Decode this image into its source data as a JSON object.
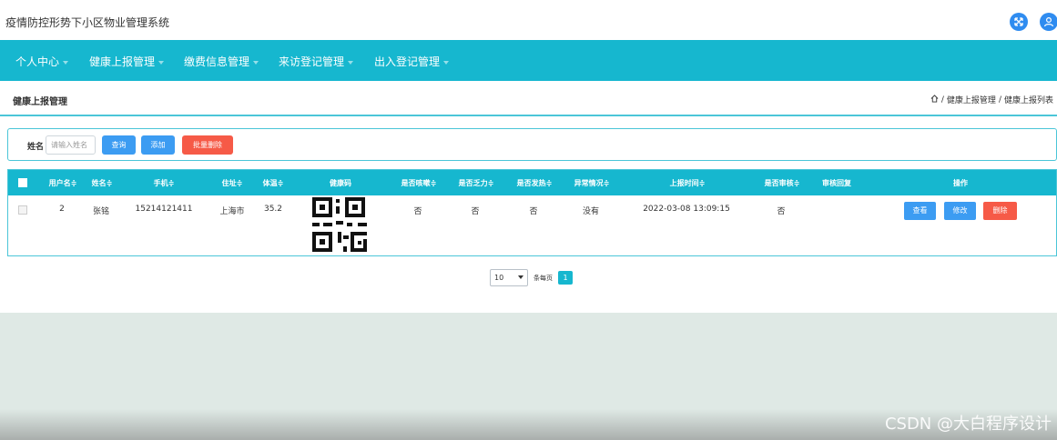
{
  "app": {
    "title": "疫情防控形势下小区物业管理系统"
  },
  "colors": {
    "accent": "#16b7cf",
    "primary_button": "#3c9cf2",
    "danger_button": "#f65a47",
    "background": "#dfe9e5"
  },
  "nav": {
    "items": [
      {
        "label": "个人中心"
      },
      {
        "label": "健康上报管理"
      },
      {
        "label": "缴费信息管理"
      },
      {
        "label": "来访登记管理"
      },
      {
        "label": "出入登记管理"
      }
    ]
  },
  "page": {
    "title": "健康上报管理",
    "breadcrumb": {
      "sep": "/",
      "level1": "健康上报管理",
      "level2": "健康上报列表"
    }
  },
  "search": {
    "label": "姓名",
    "placeholder": "请输入姓名",
    "query_label": "查询",
    "add_label": "添加",
    "batch_delete_label": "批量删除"
  },
  "table": {
    "headers": [
      "用户名≑",
      "姓名≑",
      "手机≑",
      "住址≑",
      "体温≑",
      "健康码",
      "是否咳嗽≑",
      "是否乏力≑",
      "是否发热≑",
      "异常情况≑",
      "上报时间≑",
      "是否审核≑",
      "审核回复",
      "操作"
    ],
    "rows": [
      {
        "username": "2",
        "name": "张铭",
        "phone": "15214121411",
        "address": "上海市",
        "temperature": "35.2",
        "cough": "否",
        "fatigue": "否",
        "fever": "否",
        "abnormal": "没有",
        "report_time": "2022-03-08 13:09:15",
        "audited": "否",
        "audit_reply": "",
        "actions": {
          "view": "查看",
          "edit": "修改",
          "delete": "删除"
        }
      }
    ]
  },
  "pagination": {
    "page_size": "10",
    "per_page_label": "条每页",
    "current_page": "1"
  },
  "watermark": "CSDN @大白程序设计"
}
